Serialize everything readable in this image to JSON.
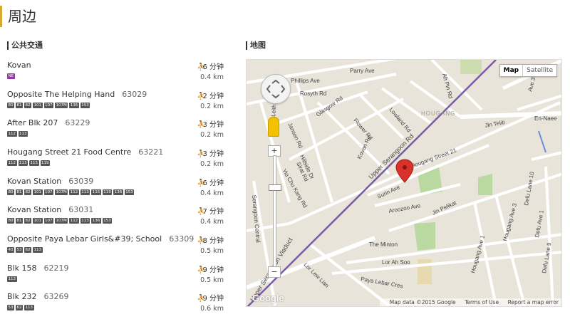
{
  "page": {
    "title": "周边"
  },
  "transit": {
    "heading": "公共交通",
    "stops": [
      {
        "name": "Kovan",
        "code": "",
        "badges": [
          "NE"
        ],
        "walk": "6 分钟",
        "distance": "0.4 km"
      },
      {
        "name": "Opposite The Helping Hand",
        "code": "63029",
        "badges": [
          "80",
          "81",
          "82",
          "101",
          "107",
          "107M",
          "136",
          "153"
        ],
        "walk": "2 分钟",
        "distance": "0.2 km"
      },
      {
        "name": "After Blk 207",
        "code": "63229",
        "badges": [
          "112",
          "113"
        ],
        "walk": "3 分钟",
        "distance": "0.2 km"
      },
      {
        "name": "Hougang Street 21 Food Centre",
        "code": "63221",
        "badges": [
          "112",
          "113",
          "115",
          "119"
        ],
        "walk": "3 分钟",
        "distance": "0.2 km"
      },
      {
        "name": "Kovan Station",
        "code": "63039",
        "badges": [
          "80",
          "81",
          "82",
          "101",
          "107",
          "107M",
          "112",
          "113",
          "115",
          "119",
          "136",
          "153"
        ],
        "walk": "6 分钟",
        "distance": "0.4 km"
      },
      {
        "name": "Kovan Station",
        "code": "63031",
        "badges": [
          "80",
          "81",
          "82",
          "101",
          "107",
          "107M",
          "112",
          "113",
          "136",
          "153"
        ],
        "walk": "7 分钟",
        "distance": "0.4 km"
      },
      {
        "name": "Opposite Paya Lebar Girls&#39; School",
        "code": "63309",
        "badges": [
          "43",
          "53",
          "62",
          "113"
        ],
        "walk": "8 分钟",
        "distance": "0.5 km"
      },
      {
        "name": "Blk 158",
        "code": "62219",
        "badges": [
          "113"
        ],
        "walk": "9 分钟",
        "distance": "0.5 km"
      },
      {
        "name": "Blk 232",
        "code": "63269",
        "badges": [
          "53",
          "62",
          "113"
        ],
        "walk": "9 分钟",
        "distance": "0.6 km"
      }
    ]
  },
  "map": {
    "heading": "地图",
    "type_map": "Map",
    "type_satellite": "Satellite",
    "attribution": {
      "data": "Map data ©2015 Google",
      "terms": "Terms of Use",
      "report": "Report a map error"
    },
    "logo": "Google",
    "zoom_in": "+",
    "zoom_out": "−",
    "labels": {
      "parry": "Parry Ave",
      "phillips": "Phillips Ave",
      "rosyth": "Rosyth Rd",
      "glasgow": "Glasgow Rd",
      "jansen": "Jansen Rd",
      "leith": "Leith Rd",
      "flower": "Flower Rd",
      "lowland": "Lowland Rd",
      "hougang": "HOUGANG",
      "upper_serangoon_rd": "Upper Serangoon Rd",
      "kovan": "Kovan Rd",
      "hillside": "Hillside Dr",
      "sirat": "Sirat Rd",
      "yio_chu_kang": "Yio Chu Kang Rd",
      "hougang_st21": "Hougang Street 21",
      "surin": "Surin Ave",
      "aroozoo": "Aroozoo Ave",
      "jln_pelikat": "Jln Pelikat",
      "jln_teliti": "Jln Teliti",
      "en_naee": "En-Naee",
      "minton": "The Minton",
      "lor_ah_soo": "Lor Ah Soo",
      "lor_lew_lian": "Lor Lew Lian",
      "paya_lebar_cres": "Paya Lebar Cres",
      "viaduct": "Upper Serangoon Viaduct",
      "serangoon_central": "Serangoon Central",
      "hougang_ave1": "Hougang Ave 1",
      "hougang_ave3": "Hougang Ave 3",
      "defu10": "Defu Lane 10",
      "defu9": "Defu Lane 9",
      "defu_ave1": "Defu Ave 1",
      "ave3": "Ave 3",
      "ah_pin": "Ah Pin Rd"
    }
  }
}
